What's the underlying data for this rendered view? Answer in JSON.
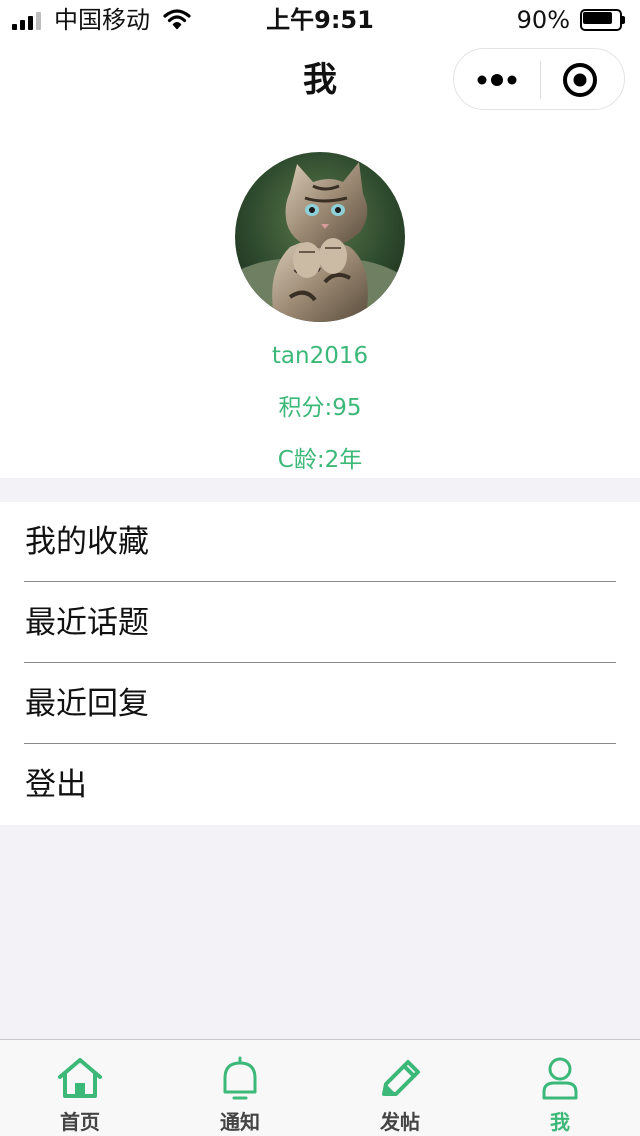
{
  "status_bar": {
    "carrier": "中国移动",
    "time": "上午9:51",
    "battery_percent": "90%",
    "battery_level": 0.9,
    "icons": [
      "signal-icon",
      "wifi-icon",
      "battery-icon"
    ]
  },
  "nav": {
    "title": "我",
    "more_icon": "more-dots-icon",
    "close_icon": "target-circle-icon"
  },
  "profile": {
    "avatar_icon": "kitten-avatar",
    "username": "tan2016",
    "points": "积分:95",
    "c_age": "C龄:2年"
  },
  "menu": {
    "items": [
      {
        "label": "我的收藏"
      },
      {
        "label": "最近话题"
      },
      {
        "label": "最近回复"
      },
      {
        "label": "登出"
      }
    ]
  },
  "tabbar": {
    "items": [
      {
        "label": "首页",
        "icon": "home-icon"
      },
      {
        "label": "通知",
        "icon": "bell-icon"
      },
      {
        "label": "发帖",
        "icon": "pencil-icon"
      },
      {
        "label": "我",
        "icon": "user-icon"
      }
    ],
    "active_index": 3
  },
  "colors": {
    "accent": "#3cb878",
    "background": "#f3f3f7",
    "text": "#111111"
  }
}
